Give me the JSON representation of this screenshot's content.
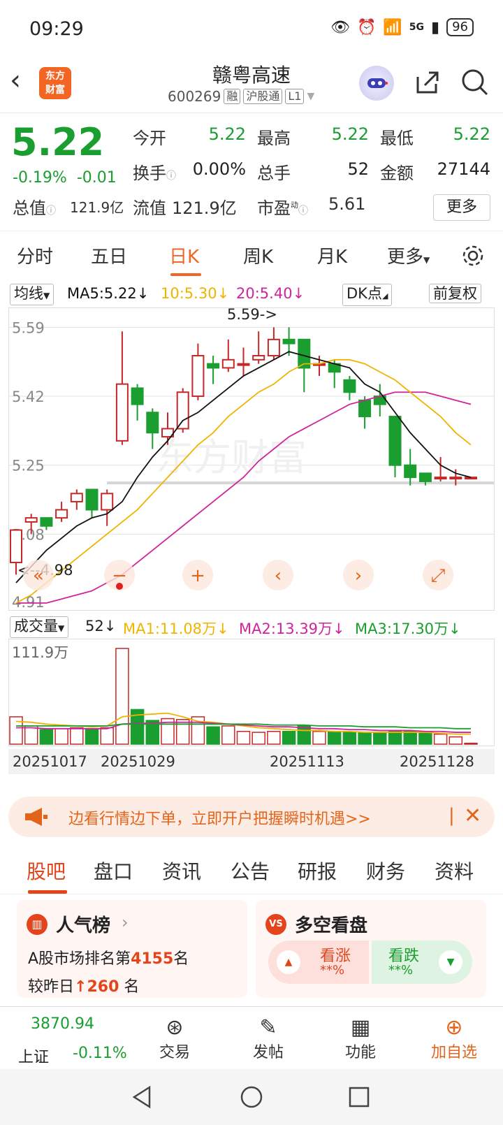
{
  "status": {
    "time": "09:29",
    "network": "5G",
    "battery": "96"
  },
  "header": {
    "logo_text": "东方\n财富",
    "stock_name": "赣粤高速",
    "code": "600269",
    "tag_rong": "融",
    "tag_hgt": "沪股通",
    "tag_l1": "L1"
  },
  "quote": {
    "price": "5.22",
    "change_pct": "-0.19%",
    "change": "-0.01",
    "open_label": "今开",
    "open": "5.22",
    "high_label": "最高",
    "high": "5.22",
    "low_label": "最低",
    "low": "5.22",
    "turnover_label": "换手",
    "turnover": "0.00%",
    "vol_label": "总手",
    "vol": "52",
    "amount_label": "金额",
    "amount": "27144",
    "mktcap_label": "总值",
    "mktcap": "121.9亿",
    "float_label": "流值",
    "float": "121.9亿",
    "pe_label": "市盈",
    "pe_sup": "动",
    "pe": "5.61",
    "more": "更多"
  },
  "tabs": [
    "分时",
    "五日",
    "日K",
    "周K",
    "月K",
    "更多"
  ],
  "ma": {
    "selector": "均线",
    "ma5": "MA5:5.22",
    "ma10": "10:5.30",
    "ma20": "20:5.40",
    "dk": "DK点",
    "fq": "前复权"
  },
  "chart_labels": {
    "y1": "5.59",
    "y2": "5.42",
    "y3": "5.25",
    "y4": "5.08",
    "y5": "4.91",
    "hi_mark": "5.59",
    "lo_mark": "4.98",
    "watermark": "东方财富"
  },
  "volume": {
    "selector": "成交量",
    "vol": "52",
    "ma1": "MA1:11.08万",
    "ma2": "MA2:13.39万",
    "ma3": "MA3:17.30万",
    "max": "111.9万"
  },
  "dates": [
    "20251017",
    "20251029",
    "20251113",
    "20251128"
  ],
  "promo": {
    "text": "边看行情边下单，立即开户把握瞬时机遇>>"
  },
  "ftabs": [
    "股吧",
    "盘口",
    "资讯",
    "公告",
    "研报",
    "财务",
    "资料"
  ],
  "cards": {
    "pop_title": "人气榜",
    "pop_line1_a": "A股市场排名第",
    "pop_rank": "4155",
    "pop_line1_b": "名",
    "pop_line2_a": "较昨日",
    "pop_delta": "260",
    "pop_line2_b": "名",
    "vs_title": "多空看盘",
    "vs_up": "看涨",
    "vs_up_val": "**%",
    "vs_down": "看跌",
    "vs_down_val": "**%"
  },
  "bottom": {
    "index_val": "3870.94",
    "index_name": "上证",
    "index_chg": "-0.11%",
    "trade": "交易",
    "post": "发帖",
    "func": "功能",
    "add": "加自选"
  },
  "colors": {
    "up": "#c62828",
    "down": "#1a9e2f",
    "ma5": "#111111",
    "ma10": "#f0b400",
    "ma20": "#d0249b",
    "accent": "#f26522"
  },
  "chart_data": {
    "type": "candlestick",
    "categories": [
      "20251017",
      "",
      "",
      "",
      "",
      "",
      "",
      "20251029",
      "",
      "",
      "",
      "",
      "",
      "",
      "",
      "",
      "",
      "",
      "20251113",
      "",
      "",
      "",
      "",
      "",
      "",
      "",
      "",
      "",
      "",
      "",
      "20251128"
    ],
    "ylim": [
      4.91,
      5.62
    ],
    "candles": [
      {
        "o": 5.01,
        "c": 5.09,
        "h": 5.09,
        "l": 4.98
      },
      {
        "o": 5.11,
        "c": 5.12,
        "h": 5.13,
        "l": 5.08
      },
      {
        "o": 5.12,
        "c": 5.1,
        "h": 5.12,
        "l": 5.09
      },
      {
        "o": 5.12,
        "c": 5.14,
        "h": 5.16,
        "l": 5.11
      },
      {
        "o": 5.16,
        "c": 5.18,
        "h": 5.19,
        "l": 5.14
      },
      {
        "o": 5.19,
        "c": 5.14,
        "h": 5.19,
        "l": 5.12
      },
      {
        "o": 5.14,
        "c": 5.18,
        "h": 5.19,
        "l": 5.1
      },
      {
        "o": 5.31,
        "c": 5.45,
        "h": 5.58,
        "l": 5.3
      },
      {
        "o": 5.44,
        "c": 5.4,
        "h": 5.45,
        "l": 5.36
      },
      {
        "o": 5.38,
        "c": 5.33,
        "h": 5.39,
        "l": 5.29
      },
      {
        "o": 5.32,
        "c": 5.34,
        "h": 5.38,
        "l": 5.3
      },
      {
        "o": 5.34,
        "c": 5.43,
        "h": 5.44,
        "l": 5.33
      },
      {
        "o": 5.42,
        "c": 5.52,
        "h": 5.55,
        "l": 5.41
      },
      {
        "o": 5.5,
        "c": 5.49,
        "h": 5.52,
        "l": 5.45
      },
      {
        "o": 5.49,
        "c": 5.51,
        "h": 5.56,
        "l": 5.48
      },
      {
        "o": 5.5,
        "c": 5.5,
        "h": 5.54,
        "l": 5.47
      },
      {
        "o": 5.51,
        "c": 5.52,
        "h": 5.58,
        "l": 5.5
      },
      {
        "o": 5.52,
        "c": 5.56,
        "h": 5.59,
        "l": 5.51
      },
      {
        "o": 5.56,
        "c": 5.55,
        "h": 5.59,
        "l": 5.52
      },
      {
        "o": 5.56,
        "c": 5.49,
        "h": 5.56,
        "l": 5.43
      },
      {
        "o": 5.5,
        "c": 5.5,
        "h": 5.52,
        "l": 5.47
      },
      {
        "o": 5.5,
        "c": 5.48,
        "h": 5.51,
        "l": 5.44
      },
      {
        "o": 5.46,
        "c": 5.43,
        "h": 5.47,
        "l": 5.41
      },
      {
        "o": 5.41,
        "c": 5.37,
        "h": 5.42,
        "l": 5.34
      },
      {
        "o": 5.42,
        "c": 5.4,
        "h": 5.45,
        "l": 5.37
      },
      {
        "o": 5.37,
        "c": 5.25,
        "h": 5.37,
        "l": 5.22
      },
      {
        "o": 5.25,
        "c": 5.22,
        "h": 5.29,
        "l": 5.2
      },
      {
        "o": 5.23,
        "c": 5.21,
        "h": 5.23,
        "l": 5.2
      },
      {
        "o": 5.22,
        "c": 5.22,
        "h": 5.27,
        "l": 5.21
      },
      {
        "o": 5.22,
        "c": 5.22,
        "h": 5.24,
        "l": 5.2
      },
      {
        "o": 5.22,
        "c": 5.22,
        "h": 5.22,
        "l": 5.22
      }
    ],
    "ma5": [
      4.96,
      5.0,
      5.04,
      5.07,
      5.1,
      5.12,
      5.13,
      5.16,
      5.22,
      5.27,
      5.31,
      5.36,
      5.38,
      5.41,
      5.44,
      5.47,
      5.49,
      5.51,
      5.53,
      5.52,
      5.51,
      5.5,
      5.49,
      5.45,
      5.43,
      5.38,
      5.33,
      5.29,
      5.25,
      5.23,
      5.22
    ],
    "ma10": [
      4.91,
      4.93,
      4.96,
      4.99,
      5.02,
      5.05,
      5.08,
      5.11,
      5.14,
      5.18,
      5.22,
      5.26,
      5.3,
      5.33,
      5.37,
      5.4,
      5.43,
      5.45,
      5.48,
      5.5,
      5.5,
      5.51,
      5.51,
      5.5,
      5.48,
      5.46,
      5.43,
      5.4,
      5.37,
      5.33,
      5.3
    ],
    "ma20": [
      4.91,
      4.91,
      4.91,
      4.92,
      4.93,
      4.94,
      4.96,
      4.98,
      5.01,
      5.04,
      5.07,
      5.1,
      5.13,
      5.16,
      5.19,
      5.22,
      5.26,
      5.29,
      5.32,
      5.34,
      5.36,
      5.38,
      5.4,
      5.41,
      5.42,
      5.43,
      5.43,
      5.43,
      5.42,
      5.41,
      5.4
    ],
    "volumes": [
      30,
      20,
      16,
      17,
      18,
      16,
      18,
      105,
      38,
      26,
      28,
      27,
      30,
      19,
      20,
      14,
      13,
      14,
      14,
      20,
      14,
      14,
      13,
      13,
      13,
      14,
      14,
      14,
      11,
      8,
      1
    ],
    "vol_ma1": [
      25,
      24,
      22,
      21,
      20,
      19,
      20,
      30,
      32,
      33,
      34,
      30,
      25,
      24,
      22,
      20,
      18,
      17,
      16,
      15,
      15,
      14,
      14,
      13,
      13,
      13,
      13,
      13,
      12,
      11,
      11
    ],
    "vol_ma2": [
      18,
      18,
      17,
      17,
      17,
      17,
      17,
      22,
      23,
      23,
      24,
      24,
      24,
      23,
      22,
      21,
      20,
      19,
      19,
      18,
      17,
      17,
      16,
      16,
      15,
      15,
      15,
      14,
      14,
      13,
      13
    ],
    "vol_ma3": [
      20,
      20,
      20,
      20,
      20,
      20,
      20,
      22,
      22,
      22,
      22,
      22,
      22,
      22,
      22,
      22,
      22,
      21,
      21,
      21,
      20,
      20,
      20,
      19,
      19,
      19,
      18,
      18,
      18,
      17,
      17
    ]
  }
}
